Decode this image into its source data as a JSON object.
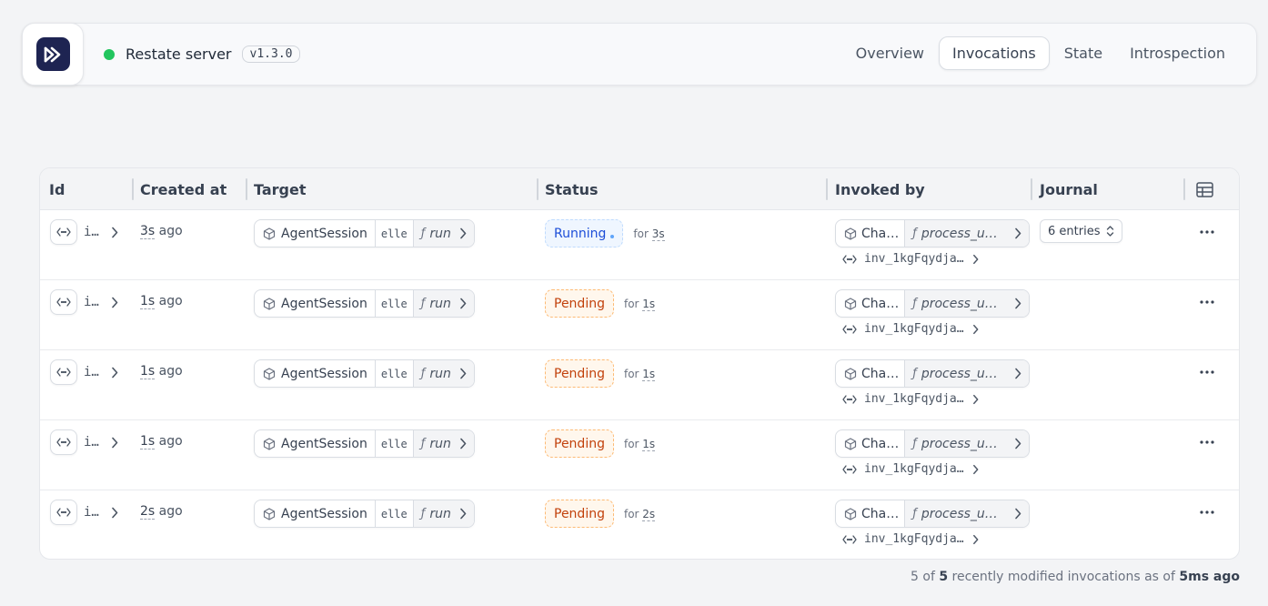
{
  "header": {
    "server_name": "Restate server",
    "version": "v1.3.0",
    "status_color": "#22c55e",
    "nav": [
      {
        "label": "Overview",
        "active": false
      },
      {
        "label": "Invocations",
        "active": true
      },
      {
        "label": "State",
        "active": false
      },
      {
        "label": "Introspection",
        "active": false
      }
    ]
  },
  "table": {
    "columns": [
      "Id",
      "Created at",
      "Target",
      "Status",
      "Invoked by",
      "Journal"
    ],
    "rows": [
      {
        "id": "i…",
        "created_num": "3s",
        "created_suffix": " ago",
        "target_service": "AgentSession",
        "target_key": "elle",
        "target_handler": "run",
        "status": "Running",
        "status_for_prefix": "for ",
        "status_for_num": "3s",
        "invoker_service": "Cha…",
        "invoker_handler": "process_u…",
        "invoker_id": "inv_1kgFqydja…",
        "journal": "6 entries"
      },
      {
        "id": "i…",
        "created_num": "1s",
        "created_suffix": " ago",
        "target_service": "AgentSession",
        "target_key": "elle",
        "target_handler": "run",
        "status": "Pending",
        "status_for_prefix": "for ",
        "status_for_num": "1s",
        "invoker_service": "Cha…",
        "invoker_handler": "process_u…",
        "invoker_id": "inv_1kgFqydja…",
        "journal": ""
      },
      {
        "id": "i…",
        "created_num": "1s",
        "created_suffix": " ago",
        "target_service": "AgentSession",
        "target_key": "elle",
        "target_handler": "run",
        "status": "Pending",
        "status_for_prefix": "for ",
        "status_for_num": "1s",
        "invoker_service": "Cha…",
        "invoker_handler": "process_u…",
        "invoker_id": "inv_1kgFqydja…",
        "journal": ""
      },
      {
        "id": "i…",
        "created_num": "1s",
        "created_suffix": " ago",
        "target_service": "AgentSession",
        "target_key": "elle",
        "target_handler": "run",
        "status": "Pending",
        "status_for_prefix": "for ",
        "status_for_num": "1s",
        "invoker_service": "Cha…",
        "invoker_handler": "process_u…",
        "invoker_id": "inv_1kgFqydja…",
        "journal": ""
      },
      {
        "id": "i…",
        "created_num": "2s",
        "created_suffix": " ago",
        "target_service": "AgentSession",
        "target_key": "elle",
        "target_handler": "run",
        "status": "Pending",
        "status_for_prefix": "for ",
        "status_for_num": "2s",
        "invoker_service": "Cha…",
        "invoker_handler": "process_u…",
        "invoker_id": "inv_1kgFqydja…",
        "journal": ""
      }
    ]
  },
  "footer": {
    "count": "5",
    "mid_text": " of ",
    "total": "5",
    "text": " recently modified invocations as of ",
    "time": "5ms ago"
  },
  "icons": {
    "logo": "restate-logo-icon",
    "id": "code-brackets-icon",
    "service": "cube-icon",
    "handler": "function-icon",
    "chevron": "chevron-right-icon",
    "journal": "chevron-up-down-icon",
    "more": "more-horizontal-icon",
    "columns": "table-columns-icon"
  }
}
